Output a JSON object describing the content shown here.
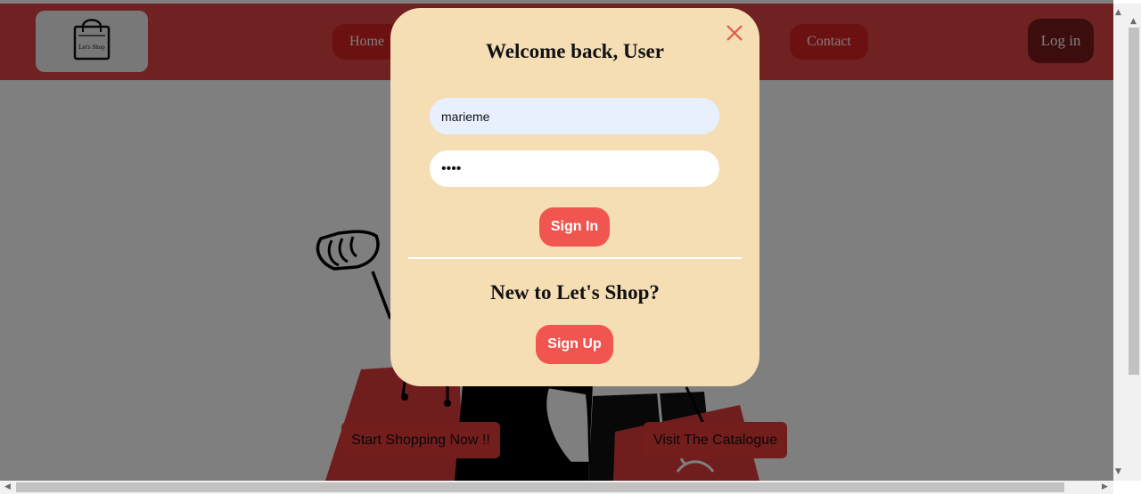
{
  "navbar": {
    "logo_text": "Let's Shop",
    "home_label": "Home",
    "contact_label": "Contact",
    "login_label": "Log in"
  },
  "hero": {
    "cta_start_label": "Start Shopping Now !!",
    "cta_visit_label": "Visit The Catalogue"
  },
  "modal": {
    "title": "Welcome back, User",
    "username_value": "marieme",
    "password_value": "••••",
    "signin_label": "Sign In",
    "new_user_heading": "New to Let's Shop?",
    "signup_label": "Sign Up",
    "close_icon": "close-icon"
  },
  "colors": {
    "navbar": "#e14444",
    "nav_pill": "#d92222",
    "login": "#7a1a1a",
    "modal_bg": "#f5ddb4",
    "button": "#f05550",
    "close": "#e45a4a"
  }
}
